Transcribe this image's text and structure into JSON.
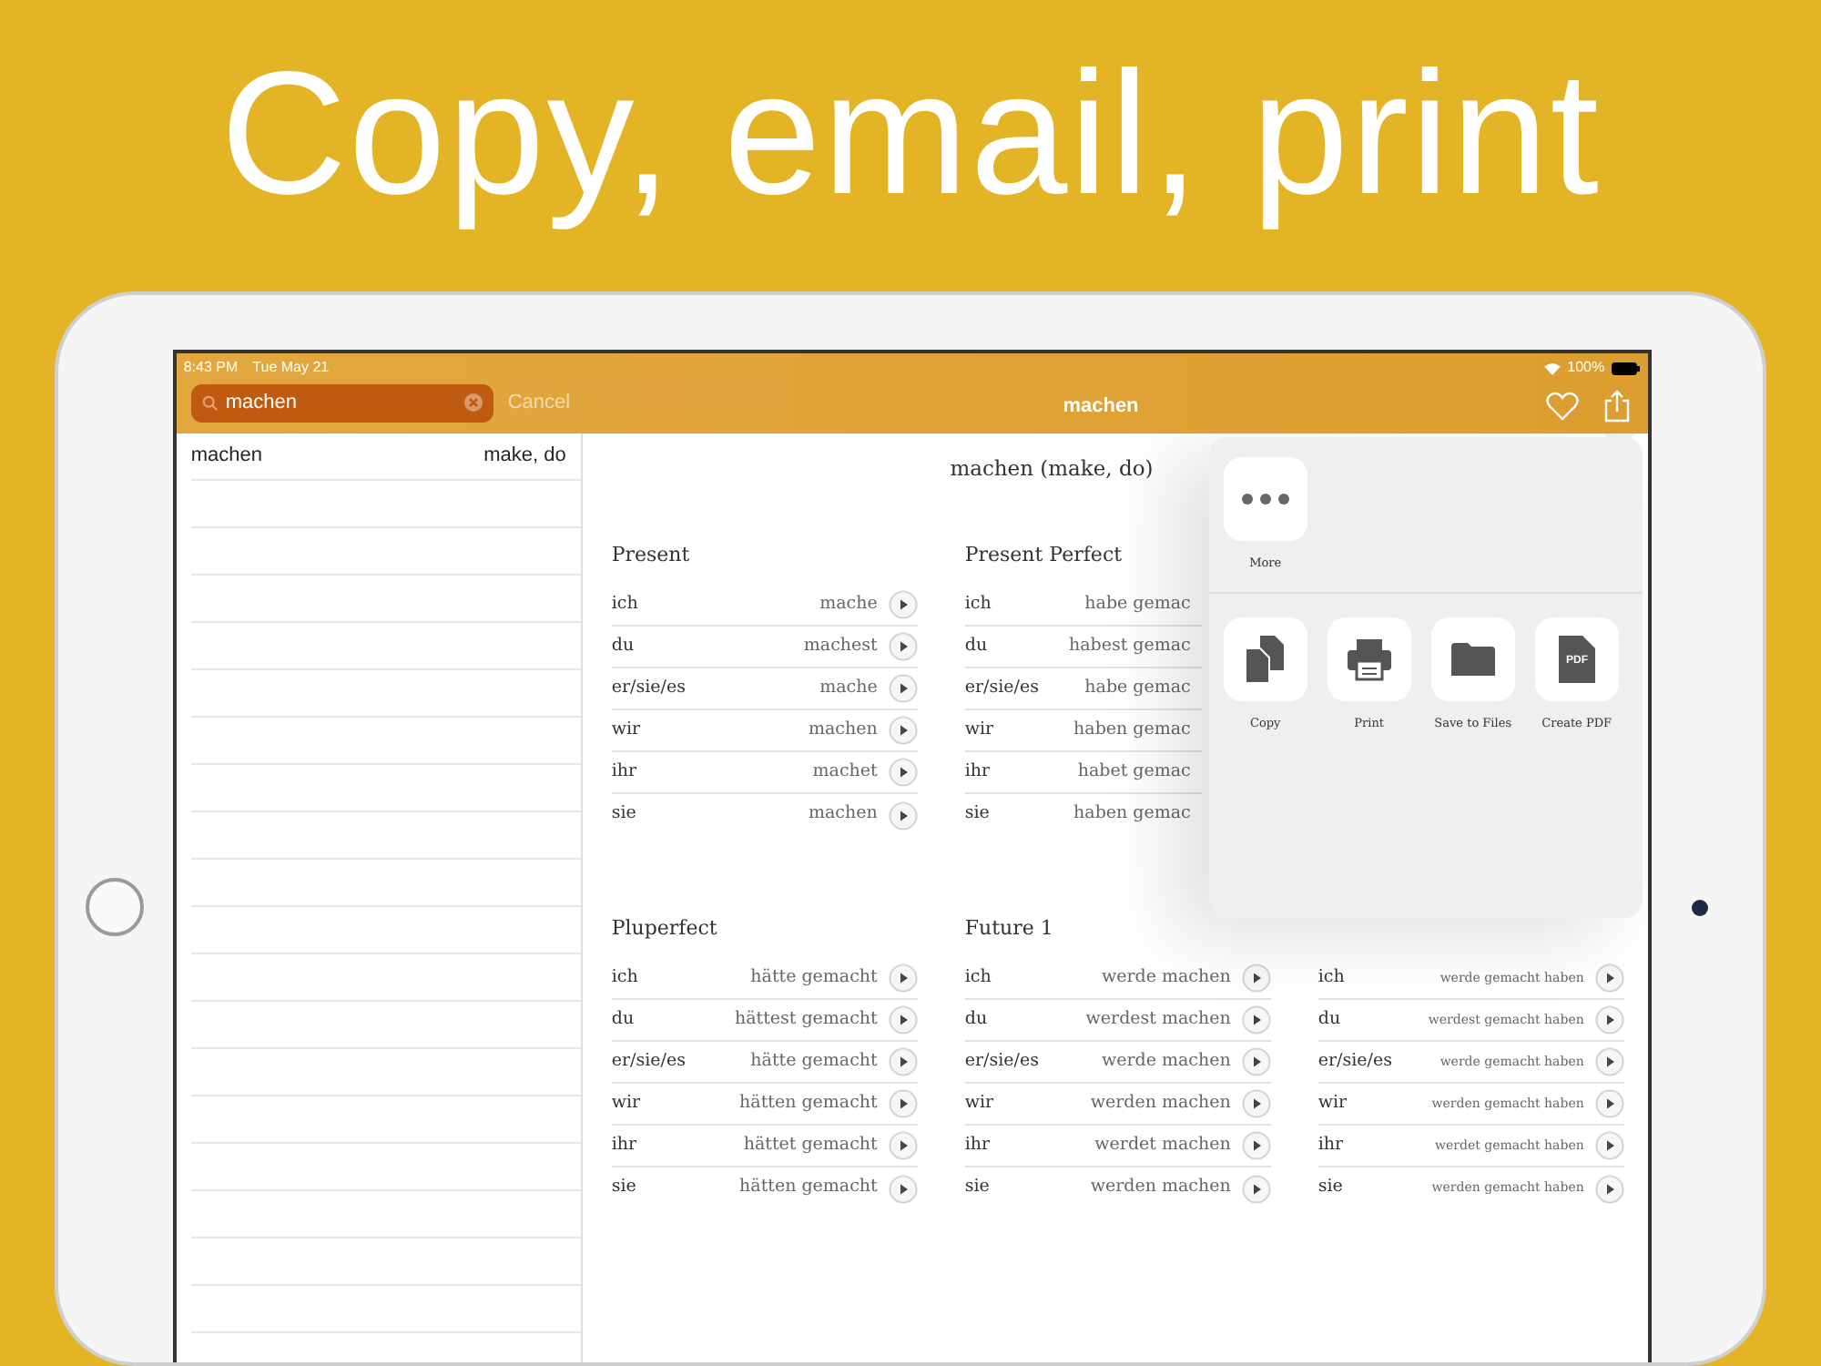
{
  "headline": "Copy, email, print",
  "status_bar": {
    "time": "8:43 PM",
    "date": "Tue May 21",
    "battery": "100%"
  },
  "search": {
    "value": "machen",
    "cancel": "Cancel"
  },
  "nav": {
    "title": "machen"
  },
  "sidebar": {
    "items": [
      {
        "word": "machen",
        "meaning": "make, do"
      }
    ]
  },
  "heading": "machen (make, do)",
  "sections": [
    {
      "columns": [
        {
          "title": "Present",
          "rows": [
            {
              "pronoun": "ich",
              "form": "mache"
            },
            {
              "pronoun": "du",
              "form": "machest"
            },
            {
              "pronoun": "er/sie/es",
              "form": "mache"
            },
            {
              "pronoun": "wir",
              "form": "machen"
            },
            {
              "pronoun": "ihr",
              "form": "machet"
            },
            {
              "pronoun": "sie",
              "form": "machen"
            }
          ]
        },
        {
          "title": "Present Perfect",
          "cut": true,
          "rows": [
            {
              "pronoun": "ich",
              "form": "habe gemac"
            },
            {
              "pronoun": "du",
              "form": "habest gemac"
            },
            {
              "pronoun": "er/sie/es",
              "form": "habe gemac"
            },
            {
              "pronoun": "wir",
              "form": "haben gemac"
            },
            {
              "pronoun": "ihr",
              "form": "habet gemac"
            },
            {
              "pronoun": "sie",
              "form": "haben gemac"
            }
          ]
        }
      ]
    },
    {
      "columns": [
        {
          "title": "Pluperfect",
          "rows": [
            {
              "pronoun": "ich",
              "form": "hätte gemacht"
            },
            {
              "pronoun": "du",
              "form": "hättest gemacht"
            },
            {
              "pronoun": "er/sie/es",
              "form": "hätte gemacht"
            },
            {
              "pronoun": "wir",
              "form": "hätten gemacht"
            },
            {
              "pronoun": "ihr",
              "form": "hättet gemacht"
            },
            {
              "pronoun": "sie",
              "form": "hätten gemacht"
            }
          ]
        },
        {
          "title": "Future 1",
          "rows": [
            {
              "pronoun": "ich",
              "form": "werde machen"
            },
            {
              "pronoun": "du",
              "form": "werdest machen"
            },
            {
              "pronoun": "er/sie/es",
              "form": "werde machen"
            },
            {
              "pronoun": "wir",
              "form": "werden machen"
            },
            {
              "pronoun": "ihr",
              "form": "werdet machen"
            },
            {
              "pronoun": "sie",
              "form": "werden machen"
            }
          ]
        },
        {
          "rows": [
            {
              "pronoun": "ich",
              "form": "werde gemacht haben"
            },
            {
              "pronoun": "du",
              "form": "werdest gemacht haben"
            },
            {
              "pronoun": "er/sie/es",
              "form": "werde gemacht haben"
            },
            {
              "pronoun": "wir",
              "form": "werden gemacht haben"
            },
            {
              "pronoun": "ihr",
              "form": "werdet gemacht haben"
            },
            {
              "pronoun": "sie",
              "form": "werden gemacht haben"
            }
          ]
        }
      ]
    }
  ],
  "share_sheet": {
    "top": [
      {
        "kind": "more",
        "label": "More"
      }
    ],
    "actions": [
      {
        "kind": "copy",
        "label": "Copy"
      },
      {
        "kind": "print",
        "label": "Print"
      },
      {
        "kind": "files",
        "label": "Save to Files"
      },
      {
        "kind": "pdf",
        "label": "Create PDF",
        "badge": "PDF"
      }
    ]
  }
}
